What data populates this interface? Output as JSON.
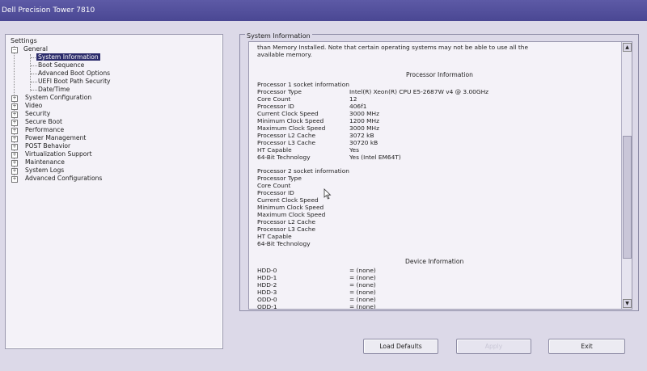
{
  "window": {
    "title": "Dell Precision Tower 7810"
  },
  "tree": {
    "root_label": "Settings",
    "items": [
      {
        "label": "General",
        "expander": "-"
      },
      {
        "label": "System Information",
        "selected": true
      },
      {
        "label": "Boot Sequence"
      },
      {
        "label": "Advanced Boot Options"
      },
      {
        "label": "UEFI Boot Path Security"
      },
      {
        "label": "Date/Time"
      },
      {
        "label": "System Configuration",
        "expander": "+"
      },
      {
        "label": "Video",
        "expander": "+"
      },
      {
        "label": "Security",
        "expander": "+"
      },
      {
        "label": "Secure Boot",
        "expander": "+"
      },
      {
        "label": "Performance",
        "expander": "+"
      },
      {
        "label": "Power Management",
        "expander": "+"
      },
      {
        "label": "POST Behavior",
        "expander": "+"
      },
      {
        "label": "Virtualization Support",
        "expander": "+"
      },
      {
        "label": "Maintenance",
        "expander": "+"
      },
      {
        "label": "System Logs",
        "expander": "+"
      },
      {
        "label": "Advanced Configurations",
        "expander": "+"
      }
    ]
  },
  "panel": {
    "legend": "System Information",
    "intro_line1": "than Memory Installed. Note that certain operating systems may not be able to use all the",
    "intro_line2": "available memory.",
    "processor_header": "Processor Information",
    "proc1_title": "Processor 1 socket information",
    "proc1_rows": [
      {
        "label": "Processor Type",
        "value": "Intel(R) Xeon(R) CPU E5-2687W v4 @ 3.00GHz"
      },
      {
        "label": "Core Count",
        "value": "12"
      },
      {
        "label": "Processor ID",
        "value": "406f1"
      },
      {
        "label": "Current Clock Speed",
        "value": "3000 MHz"
      },
      {
        "label": "Minimum Clock Speed",
        "value": "1200 MHz"
      },
      {
        "label": "Maximum Clock Speed",
        "value": "3000 MHz"
      },
      {
        "label": "Processor L2 Cache",
        "value": "3072 kB"
      },
      {
        "label": "Processor L3 Cache",
        "value": "30720 kB"
      },
      {
        "label": "HT Capable",
        "value": "Yes"
      },
      {
        "label": "64-Bit Technology",
        "value": "Yes (Intel EM64T)"
      }
    ],
    "proc2_title": "Processor 2 socket information",
    "proc2_rows": [
      {
        "label": "Processor Type"
      },
      {
        "label": "Core Count"
      },
      {
        "label": "Processor ID"
      },
      {
        "label": "Current Clock Speed"
      },
      {
        "label": "Minimum Clock Speed"
      },
      {
        "label": "Maximum Clock Speed"
      },
      {
        "label": "Processor L2 Cache"
      },
      {
        "label": "Processor L3 Cache"
      },
      {
        "label": "HT Capable"
      },
      {
        "label": "64-Bit Technology"
      }
    ],
    "device_header": "Device Information",
    "devices": [
      {
        "label": "HDD-0",
        "value": "= (none)"
      },
      {
        "label": "HDD-1",
        "value": "= (none)"
      },
      {
        "label": "HDD-2",
        "value": "= (none)"
      },
      {
        "label": "HDD-3",
        "value": "= (none)"
      },
      {
        "label": "ODD-0",
        "value": "= (none)"
      },
      {
        "label": "ODD-1",
        "value": "= (none)"
      }
    ]
  },
  "buttons": {
    "load_defaults": "Load Defaults",
    "apply": "Apply",
    "exit": "Exit"
  }
}
